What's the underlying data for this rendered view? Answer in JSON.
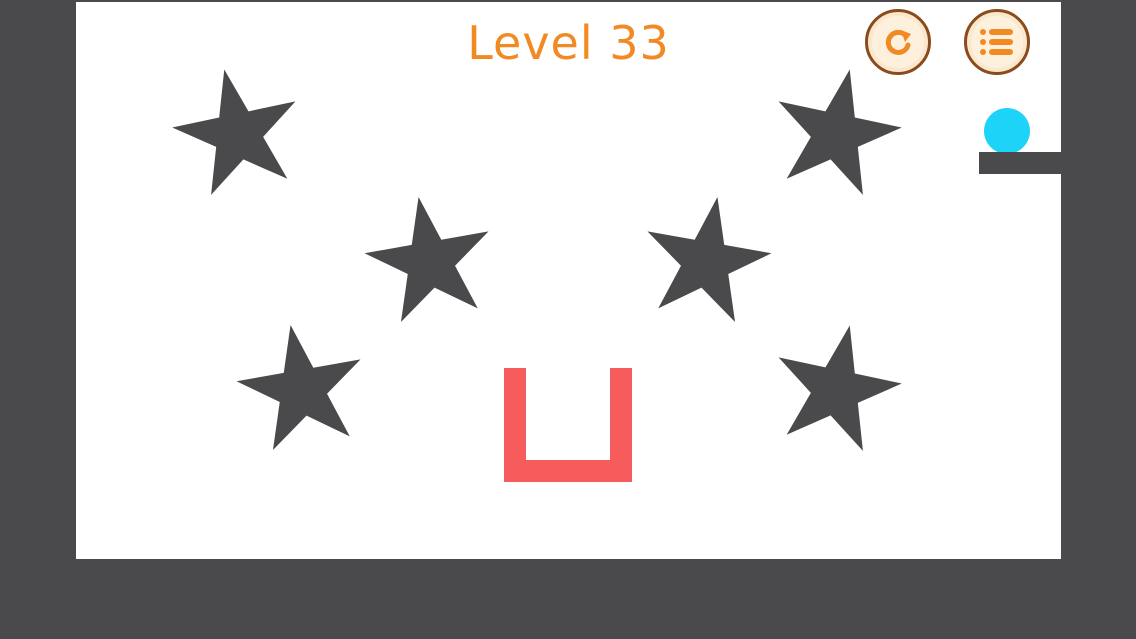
{
  "game": {
    "level_label": "Level 33"
  },
  "controls": {
    "restart_icon": "restart-icon",
    "menu_icon": "menu-list-icon"
  },
  "colors": {
    "background": "#4a494c",
    "stage": "#ffffff",
    "title": "#f28a24",
    "star": "#4a494c",
    "ball": "#1ed3f8",
    "cup": "#f65c5c",
    "button_fill": "#fbe7cc",
    "button_border": "#8a4b1d",
    "button_icon": "#f28a24"
  },
  "objects": {
    "stars_count": 6,
    "ball": "ball",
    "ledge": "ledge",
    "cup": "cup"
  }
}
